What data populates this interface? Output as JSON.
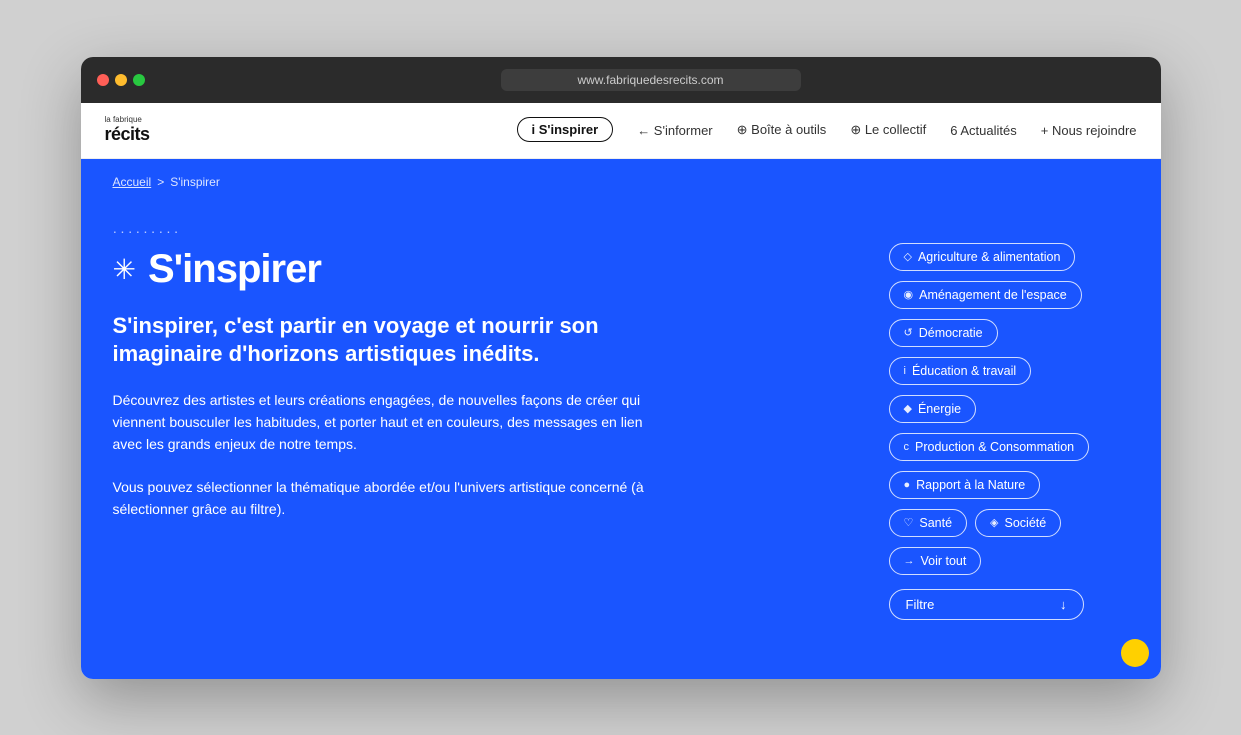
{
  "browser": {
    "url": "www.fabriquedesrecits.com"
  },
  "navbar": {
    "logo_top": "la fabrique",
    "logo_main": "récits",
    "links": [
      {
        "id": "inspirer",
        "label": "S'inspirer",
        "active": true,
        "icon": "i"
      },
      {
        "id": "informer",
        "label": "S'informer",
        "active": false,
        "icon": "←"
      },
      {
        "id": "boite",
        "label": "Boîte à outils",
        "active": false,
        "icon": "⊕"
      },
      {
        "id": "collectif",
        "label": "Le collectif",
        "active": false,
        "icon": "⊕"
      },
      {
        "id": "actualites",
        "label": "Actualités",
        "active": false,
        "icon": "6"
      },
      {
        "id": "rejoindre",
        "label": "Nous rejoindre",
        "active": false,
        "icon": "+"
      }
    ]
  },
  "breadcrumb": {
    "home": "Accueil",
    "separator": ">",
    "current": "S'inspirer"
  },
  "main": {
    "dots": "·········",
    "title_icon": "✳",
    "title": "S'inspirer",
    "subtitle": "S'inspirer, c'est partir en voyage et nourrir son imaginaire d'horizons artistiques inédits.",
    "description": "Découvrez des artistes et leurs créations engagées, de nouvelles façons de créer qui viennent bousculer les habitudes, et porter haut et en couleurs, des messages en lien avec les grands enjeux de notre temps.",
    "note": "Vous pouvez sélectionner la thématique abordée et/ou l'univers artistique concerné (à sélectionner grâce au filtre)."
  },
  "tags": [
    {
      "id": "agriculture",
      "icon": "◇",
      "label": "Agriculture & alimentation"
    },
    {
      "id": "amenagement",
      "icon": "◉",
      "label": "Aménagement de l'espace"
    },
    {
      "id": "democratie",
      "icon": "↺",
      "label": "Démocratie"
    },
    {
      "id": "education",
      "icon": "i",
      "label": "Éducation & travail"
    },
    {
      "id": "energie",
      "icon": "◆",
      "label": "Énergie"
    },
    {
      "id": "production",
      "icon": "c",
      "label": "Production & Consommation"
    },
    {
      "id": "rapport",
      "icon": "●",
      "label": "Rapport à la Nature"
    },
    {
      "id": "sante",
      "icon": "♡",
      "label": "Santé"
    },
    {
      "id": "societe",
      "icon": "◈",
      "label": "Société"
    },
    {
      "id": "voir-tout",
      "icon": "→",
      "label": "Voir tout"
    }
  ],
  "filter": {
    "label": "Filtre",
    "icon": "↓"
  }
}
